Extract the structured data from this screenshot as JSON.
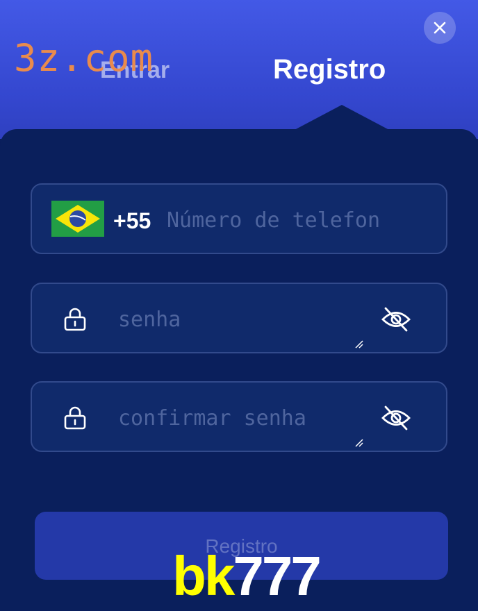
{
  "watermark": "3z.com",
  "tabs": {
    "login": "Entrar",
    "register": "Registro"
  },
  "close_icon": "close-icon",
  "phone": {
    "country_code": "+55",
    "placeholder": "Número de telefon",
    "flag": "brazil-flag-icon"
  },
  "password": {
    "placeholder": "senha",
    "icon": "lock-icon",
    "toggle_icon": "eye-off-icon"
  },
  "confirm_password": {
    "placeholder": "confirmar senha",
    "icon": "lock-icon",
    "toggle_icon": "eye-off-icon"
  },
  "submit": {
    "label": "Registro"
  },
  "brand": {
    "part1": "bk",
    "part2": "777"
  },
  "colors": {
    "accent": "#4359e6",
    "panel": "#0a1f5c",
    "field": "#102a6b",
    "button": "#2439a8",
    "brand_yellow": "#ffff00"
  }
}
